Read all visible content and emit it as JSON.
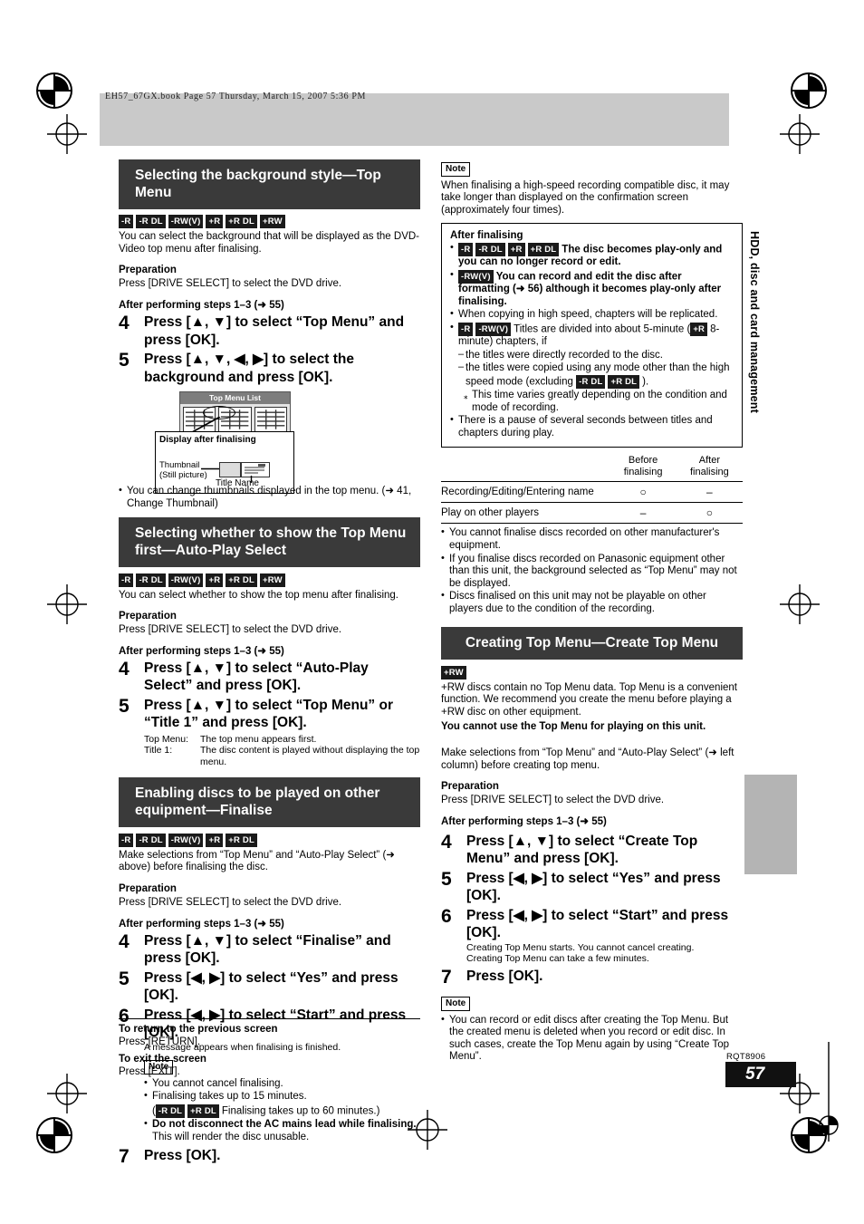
{
  "header": {
    "book_line": "EH57_67GX.book  Page 57  Thursday, March 15, 2007  5:36 PM"
  },
  "side_tab": {
    "label": "HDD, disc and card management"
  },
  "footer": {
    "rqt_code": "RQT8906",
    "page_number": "57"
  },
  "labels": {
    "preparation": "Preparation",
    "preparation_text": "Press [DRIVE SELECT] to select the DVD drive.",
    "after_steps": "After performing steps 1–3 (➜ 55)",
    "note": "Note"
  },
  "badges": {
    "r": "-R",
    "r_dl": "-R DL",
    "rw_v": "-RW(V)",
    "plus_r": "+R",
    "plus_r_dl": "+R DL",
    "plus_rw": "+RW"
  },
  "sections": {
    "background_style": {
      "title": "Selecting the background style—Top Menu",
      "intro": "You can select the background that will be displayed as the DVD-Video top menu after finalising.",
      "steps": [
        {
          "num": "4",
          "text": "Press [▲, ▼] to select “Top Menu” and press [OK]."
        },
        {
          "num": "5",
          "text": "Press [▲, ▼, ◀, ▶] to select the background and press [OK]."
        }
      ],
      "illustration": {
        "panel_title": "Top Menu List",
        "callout_title": "Display after finalising",
        "thumbnail_label": "Thumbnail",
        "thumbnail_sub": "(Still picture)",
        "title_name_label": "Title Name"
      },
      "bullet": "You can change thumbnails displayed in the top menu. (➜ 41, Change Thumbnail)"
    },
    "auto_play": {
      "title": "Selecting whether to show the Top Menu first—Auto-Play Select",
      "intro": "You can select whether to show the top menu after finalising.",
      "steps": [
        {
          "num": "4",
          "text": "Press [▲, ▼] to select “Auto-Play Select” and press [OK]."
        },
        {
          "num": "5",
          "text": "Press [▲, ▼] to select “Top Menu” or “Title 1” and press [OK]."
        }
      ],
      "option_top_menu_label": "Top Menu:",
      "option_top_menu_text": "The top menu appears first.",
      "option_title1_label": "Title 1:",
      "option_title1_text": "The disc content is played without displaying the top menu."
    },
    "finalise": {
      "title": "Enabling discs to be played on other equipment—Finalise",
      "intro": "Make selections from “Top Menu” and “Auto-Play Select” (➜ above) before finalising the disc.",
      "steps": [
        {
          "num": "4",
          "text": "Press [▲, ▼] to select “Finalise” and press [OK]."
        },
        {
          "num": "5",
          "text": "Press [◀, ▶] to select “Yes” and press [OK]."
        },
        {
          "num": "6",
          "text": "Press [◀, ▶] to select “Start” and press [OK].",
          "note": "A message appears when finalising is finished."
        },
        {
          "num": "7",
          "text": "Press [OK]."
        }
      ],
      "note_items": [
        "You cannot cancel finalising.",
        "Finalising takes up to 15 minutes."
      ],
      "note_dl_prefix": "(",
      "note_dl_text": "Finalising takes up to 60 minutes.)",
      "note_bold": "Do not disconnect the AC mains lead while finalising.",
      "note_bold_sub": "This will render the disc unusable."
    },
    "create_top_menu": {
      "title": "Creating Top Menu—Create Top Menu",
      "intro": "+RW discs contain no Top Menu data. Top Menu is a convenient function. We recommend you create the menu before playing a +RW disc on other equipment.",
      "intro_bold": "You cannot use the Top Menu for playing on this unit.",
      "make_selections": "Make selections from “Top Menu” and “Auto-Play Select” (➜ left column) before creating top menu.",
      "steps": [
        {
          "num": "4",
          "text": "Press [▲, ▼] to select “Create Top Menu” and press [OK]."
        },
        {
          "num": "5",
          "text": "Press [◀, ▶] to select “Yes” and press [OK]."
        },
        {
          "num": "6",
          "text": "Press [◀, ▶] to select “Start” and press [OK].",
          "note_1": "Creating Top Menu starts. You cannot cancel creating.",
          "note_2": "Creating Top Menu can take a few minutes."
        },
        {
          "num": "7",
          "text": "Press [OK]."
        }
      ],
      "note_item": "You can record or edit discs after creating the Top Menu. But the created menu is deleted when you record or edit disc. In such cases, create the Top Menu again by using “Create Top Menu”."
    }
  },
  "right_note": {
    "text": "When finalising a high-speed recording compatible disc, it may take longer than displayed on the confirmation screen (approximately four times)."
  },
  "after_finalising_box": {
    "title": "After finalising",
    "item1_text": "The disc becomes play-only and you can no longer record or edit.",
    "item2_text": "You can record and edit the disc after formatting (➜ 56) although it becomes play-only after finalising.",
    "item3": "When copying in high speed, chapters will be replicated.",
    "item4_pre": "Titles are divided into about 5-minute (",
    "item4_mid": "8-minute)",
    "item4_post": " chapters, if",
    "item4_dash1": "the titles were directly recorded to the disc.",
    "item4_dash2_pre": "the titles were copied using any mode other than the high speed mode (excluding",
    "item4_dash2_post": ").",
    "item4_star": "This time varies greatly depending on the condition and mode of recording.",
    "item5": "There is a pause of several seconds between titles and chapters during play."
  },
  "comparison_table": {
    "col_header_1_line1": "Before",
    "col_header_1_line2": "finalising",
    "col_header_2_line1": "After",
    "col_header_2_line2": "finalising",
    "rows": [
      {
        "label": "Recording/Editing/Entering name",
        "before": "○",
        "after": "–"
      },
      {
        "label": "Play on other players",
        "before": "–",
        "after": "○"
      }
    ]
  },
  "finalise_bullets": [
    "You cannot finalise discs recorded on other manufacturer's equipment.",
    "If you finalise discs recorded on Panasonic equipment other than this unit, the background selected as “Top Menu” may not be displayed.",
    "Discs finalised on this unit may not be playable on other players due to the condition of the recording."
  ],
  "return_exit": {
    "return_title": "To return to the previous screen",
    "return_text": "Press [RETURN].",
    "exit_title": "To exit the screen",
    "exit_text": "Press [EXIT]."
  }
}
